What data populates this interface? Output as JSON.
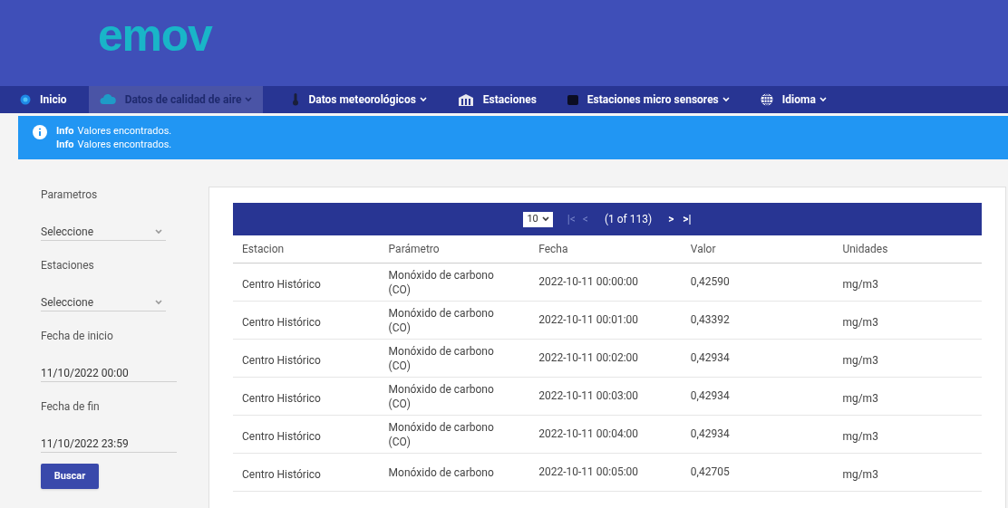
{
  "logo": "emov",
  "nav": [
    {
      "label": "Inicio",
      "selected": false,
      "caret": false
    },
    {
      "label": "Datos de calidad de aire",
      "selected": true,
      "caret": true
    },
    {
      "label": "Datos meteorológicos",
      "selected": false,
      "caret": true
    },
    {
      "label": "Estaciones",
      "selected": false,
      "caret": false
    },
    {
      "label": "Estaciones micro sensores",
      "selected": false,
      "caret": true
    },
    {
      "label": "Idioma",
      "selected": false,
      "caret": true
    }
  ],
  "messages": [
    {
      "title": "Info",
      "text": "Valores encontrados."
    },
    {
      "title": "Info",
      "text": "Valores encontrados."
    }
  ],
  "filters": [
    {
      "kind": "select",
      "label": "Parametros",
      "value": "Seleccione"
    },
    {
      "kind": "select",
      "label": "Estaciones",
      "value": "Seleccione"
    },
    {
      "kind": "date",
      "label": "Fecha de inicio",
      "value": "11/10/2022 00:00"
    },
    {
      "kind": "date",
      "label": "Fecha de fin",
      "value": "11/10/2022 23:59"
    }
  ],
  "search_button": "Buscar",
  "paginator": {
    "rows_per_page": "10",
    "first": "|<",
    "prev": "<",
    "report": "(1 of 113)",
    "next": ">",
    "last": ">|"
  },
  "table": {
    "columns": [
      "Estacion",
      "Parámetro",
      "Fecha",
      "Valor",
      "Unidades"
    ],
    "rows": [
      [
        "Centro Histórico",
        "Monóxido de carbono (CO)",
        "2022-10-11 00:00:00",
        "0,42590",
        "mg/m3"
      ],
      [
        "Centro Histórico",
        "Monóxido de carbono (CO)",
        "2022-10-11 00:01:00",
        "0,43392",
        "mg/m3"
      ],
      [
        "Centro Histórico",
        "Monóxido de carbono (CO)",
        "2022-10-11 00:02:00",
        "0,42934",
        "mg/m3"
      ],
      [
        "Centro Histórico",
        "Monóxido de carbono (CO)",
        "2022-10-11 00:03:00",
        "0,42934",
        "mg/m3"
      ],
      [
        "Centro Histórico",
        "Monóxido de carbono (CO)",
        "2022-10-11 00:04:00",
        "0,42934",
        "mg/m3"
      ],
      [
        "Centro Histórico",
        "Monóxido de carbono",
        "2022-10-11 00:05:00",
        "0,42705",
        "mg/m3"
      ]
    ]
  }
}
